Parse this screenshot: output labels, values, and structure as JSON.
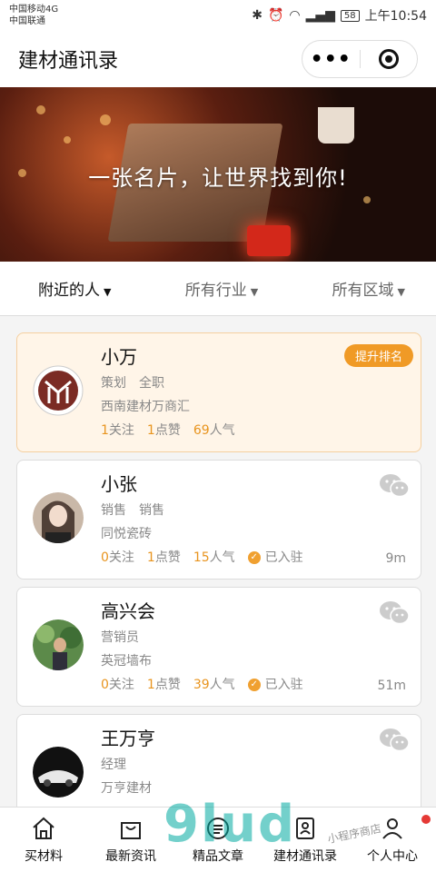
{
  "status": {
    "carrier1": "中国移动4G",
    "carrier2": "中国联通",
    "battery": "58",
    "time": "上午10:54"
  },
  "nav": {
    "title": "建材通讯录"
  },
  "banner": {
    "slogan": "一张名片，让世界找到你!"
  },
  "filters": [
    "附近的人",
    "所有行业",
    "所有区域"
  ],
  "cards": [
    {
      "name": "小万",
      "role1": "策划",
      "role2": "全职",
      "company": "西南建材万商汇",
      "follow": "1",
      "follow_label": "关注",
      "likes": "1",
      "likes_label": "点赞",
      "pop": "69",
      "pop_label": "人气",
      "boost": "提升排名"
    },
    {
      "name": "小张",
      "role1": "销售",
      "role2": "销售",
      "company": "同悦瓷砖",
      "follow": "0",
      "follow_label": "关注",
      "likes": "1",
      "likes_label": "点赞",
      "pop": "15",
      "pop_label": "人气",
      "verified": "已入驻",
      "distance": "9m"
    },
    {
      "name": "高兴会",
      "role1": "营销员",
      "role2": "",
      "company": "英冠墙布",
      "follow": "0",
      "follow_label": "关注",
      "likes": "1",
      "likes_label": "点赞",
      "pop": "39",
      "pop_label": "人气",
      "verified": "已入驻",
      "distance": "51m"
    },
    {
      "name": "王万亨",
      "role1": "经理",
      "role2": "",
      "company": "万亨建材"
    }
  ],
  "tabs": [
    "买材料",
    "最新资讯",
    "精品文章",
    "建材通讯录",
    "个人中心"
  ],
  "watermark": {
    "logo": "9lud",
    "tag": "小程序商店"
  },
  "colors": {
    "accent": "#f09a26",
    "featured_bg": "#fff5e8"
  }
}
